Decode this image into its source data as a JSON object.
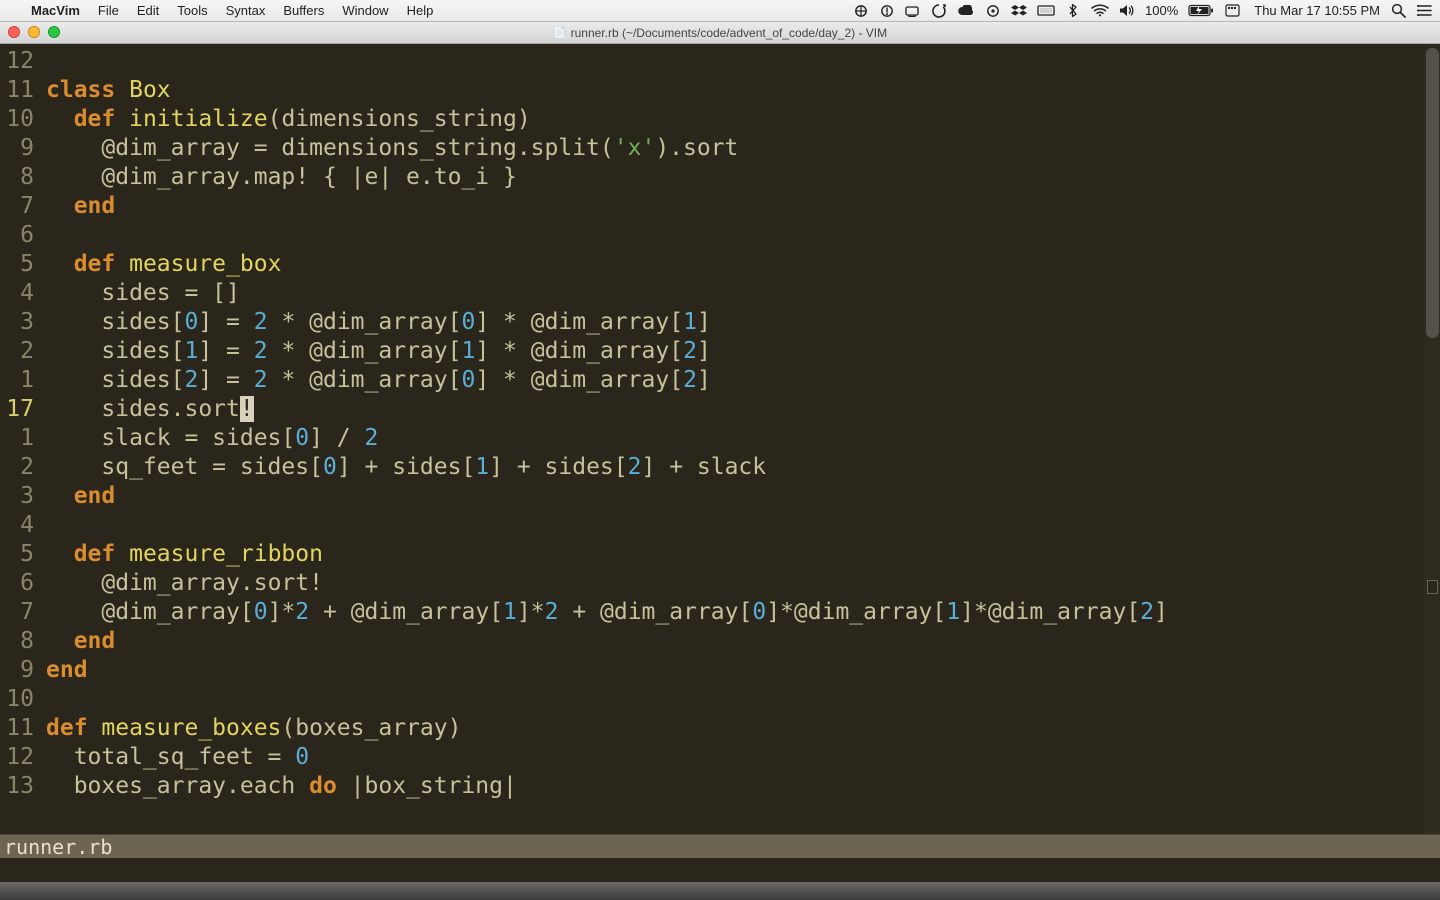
{
  "menubar": {
    "apple": "",
    "app": "MacVim",
    "items": [
      "File",
      "Edit",
      "Tools",
      "Syntax",
      "Buffers",
      "Window",
      "Help"
    ],
    "battery_pct": "100%",
    "clock": "Thu Mar 17  10:55 PM"
  },
  "titlebar": {
    "title": "runner.rb (~/Documents/code/advent_of_code/day_2) - VIM"
  },
  "status": {
    "filename": "runner.rb"
  },
  "gutter": [
    "12",
    "11",
    "10",
    "9",
    "8",
    "7",
    "6",
    "5",
    "4",
    "3",
    "2",
    "1",
    "17",
    "1",
    "2",
    "3",
    "4",
    "5",
    "6",
    "7",
    "8",
    "9",
    "10",
    "11",
    "12",
    "13"
  ],
  "gutter_current_index": 12,
  "code_lines": [
    [
      {
        "c": "plain",
        "t": ""
      }
    ],
    [
      {
        "c": "kw",
        "t": "class "
      },
      {
        "c": "name",
        "t": "Box"
      }
    ],
    [
      {
        "c": "plain",
        "t": "  "
      },
      {
        "c": "kw",
        "t": "def "
      },
      {
        "c": "name",
        "t": "initialize"
      },
      {
        "c": "punc",
        "t": "("
      },
      {
        "c": "plain",
        "t": "dimensions_string"
      },
      {
        "c": "punc",
        "t": ")"
      }
    ],
    [
      {
        "c": "plain",
        "t": "    "
      },
      {
        "c": "ivar",
        "t": "@dim_array"
      },
      {
        "c": "op",
        "t": " = "
      },
      {
        "c": "plain",
        "t": "dimensions_string.split("
      },
      {
        "c": "str",
        "t": "'x'"
      },
      {
        "c": "plain",
        "t": ").sort"
      }
    ],
    [
      {
        "c": "plain",
        "t": "    "
      },
      {
        "c": "ivar",
        "t": "@dim_array"
      },
      {
        "c": "plain",
        "t": ".map! { |e| e.to_i }"
      }
    ],
    [
      {
        "c": "plain",
        "t": "  "
      },
      {
        "c": "kw",
        "t": "end"
      }
    ],
    [
      {
        "c": "plain",
        "t": ""
      }
    ],
    [
      {
        "c": "plain",
        "t": "  "
      },
      {
        "c": "kw",
        "t": "def "
      },
      {
        "c": "name",
        "t": "measure_box"
      }
    ],
    [
      {
        "c": "plain",
        "t": "    sides = []"
      }
    ],
    [
      {
        "c": "plain",
        "t": "    sides["
      },
      {
        "c": "num",
        "t": "0"
      },
      {
        "c": "plain",
        "t": "] = "
      },
      {
        "c": "num",
        "t": "2"
      },
      {
        "c": "plain",
        "t": " * "
      },
      {
        "c": "ivar",
        "t": "@dim_array"
      },
      {
        "c": "plain",
        "t": "["
      },
      {
        "c": "num",
        "t": "0"
      },
      {
        "c": "plain",
        "t": "] * "
      },
      {
        "c": "ivar",
        "t": "@dim_array"
      },
      {
        "c": "plain",
        "t": "["
      },
      {
        "c": "num",
        "t": "1"
      },
      {
        "c": "plain",
        "t": "]"
      }
    ],
    [
      {
        "c": "plain",
        "t": "    sides["
      },
      {
        "c": "num",
        "t": "1"
      },
      {
        "c": "plain",
        "t": "] = "
      },
      {
        "c": "num",
        "t": "2"
      },
      {
        "c": "plain",
        "t": " * "
      },
      {
        "c": "ivar",
        "t": "@dim_array"
      },
      {
        "c": "plain",
        "t": "["
      },
      {
        "c": "num",
        "t": "1"
      },
      {
        "c": "plain",
        "t": "] * "
      },
      {
        "c": "ivar",
        "t": "@dim_array"
      },
      {
        "c": "plain",
        "t": "["
      },
      {
        "c": "num",
        "t": "2"
      },
      {
        "c": "plain",
        "t": "]"
      }
    ],
    [
      {
        "c": "plain",
        "t": "    sides["
      },
      {
        "c": "num",
        "t": "2"
      },
      {
        "c": "plain",
        "t": "] = "
      },
      {
        "c": "num",
        "t": "2"
      },
      {
        "c": "plain",
        "t": " * "
      },
      {
        "c": "ivar",
        "t": "@dim_array"
      },
      {
        "c": "plain",
        "t": "["
      },
      {
        "c": "num",
        "t": "0"
      },
      {
        "c": "plain",
        "t": "] * "
      },
      {
        "c": "ivar",
        "t": "@dim_array"
      },
      {
        "c": "plain",
        "t": "["
      },
      {
        "c": "num",
        "t": "2"
      },
      {
        "c": "plain",
        "t": "]"
      }
    ],
    [
      {
        "c": "plain",
        "t": "    sides.sort"
      },
      {
        "c": "cursor",
        "t": "!"
      }
    ],
    [
      {
        "c": "plain",
        "t": "    slack = sides["
      },
      {
        "c": "num",
        "t": "0"
      },
      {
        "c": "plain",
        "t": "] / "
      },
      {
        "c": "num",
        "t": "2"
      }
    ],
    [
      {
        "c": "plain",
        "t": "    sq_feet = sides["
      },
      {
        "c": "num",
        "t": "0"
      },
      {
        "c": "plain",
        "t": "] + sides["
      },
      {
        "c": "num",
        "t": "1"
      },
      {
        "c": "plain",
        "t": "] + sides["
      },
      {
        "c": "num",
        "t": "2"
      },
      {
        "c": "plain",
        "t": "] + slack"
      }
    ],
    [
      {
        "c": "plain",
        "t": "  "
      },
      {
        "c": "kw",
        "t": "end"
      }
    ],
    [
      {
        "c": "plain",
        "t": ""
      }
    ],
    [
      {
        "c": "plain",
        "t": "  "
      },
      {
        "c": "kw",
        "t": "def "
      },
      {
        "c": "name",
        "t": "measure_ribbon"
      }
    ],
    [
      {
        "c": "plain",
        "t": "    "
      },
      {
        "c": "ivar",
        "t": "@dim_array"
      },
      {
        "c": "plain",
        "t": ".sort!"
      }
    ],
    [
      {
        "c": "plain",
        "t": "    "
      },
      {
        "c": "ivar",
        "t": "@dim_array"
      },
      {
        "c": "plain",
        "t": "["
      },
      {
        "c": "num",
        "t": "0"
      },
      {
        "c": "plain",
        "t": "]*"
      },
      {
        "c": "num",
        "t": "2"
      },
      {
        "c": "plain",
        "t": " + "
      },
      {
        "c": "ivar",
        "t": "@dim_array"
      },
      {
        "c": "plain",
        "t": "["
      },
      {
        "c": "num",
        "t": "1"
      },
      {
        "c": "plain",
        "t": "]*"
      },
      {
        "c": "num",
        "t": "2"
      },
      {
        "c": "plain",
        "t": " + "
      },
      {
        "c": "ivar",
        "t": "@dim_array"
      },
      {
        "c": "plain",
        "t": "["
      },
      {
        "c": "num",
        "t": "0"
      },
      {
        "c": "plain",
        "t": "]*"
      },
      {
        "c": "ivar",
        "t": "@dim_array"
      },
      {
        "c": "plain",
        "t": "["
      },
      {
        "c": "num",
        "t": "1"
      },
      {
        "c": "plain",
        "t": "]*"
      },
      {
        "c": "ivar",
        "t": "@dim_array"
      },
      {
        "c": "plain",
        "t": "["
      },
      {
        "c": "num",
        "t": "2"
      },
      {
        "c": "plain",
        "t": "]"
      }
    ],
    [
      {
        "c": "plain",
        "t": "  "
      },
      {
        "c": "kw",
        "t": "end"
      }
    ],
    [
      {
        "c": "kw",
        "t": "end"
      }
    ],
    [
      {
        "c": "plain",
        "t": ""
      }
    ],
    [
      {
        "c": "kw",
        "t": "def "
      },
      {
        "c": "name",
        "t": "measure_boxes"
      },
      {
        "c": "punc",
        "t": "("
      },
      {
        "c": "plain",
        "t": "boxes_array"
      },
      {
        "c": "punc",
        "t": ")"
      }
    ],
    [
      {
        "c": "plain",
        "t": "  total_sq_feet = "
      },
      {
        "c": "num",
        "t": "0"
      }
    ],
    [
      {
        "c": "plain",
        "t": "  boxes_array.each "
      },
      {
        "c": "kw",
        "t": "do"
      },
      {
        "c": "plain",
        "t": " |box_string|"
      }
    ]
  ]
}
